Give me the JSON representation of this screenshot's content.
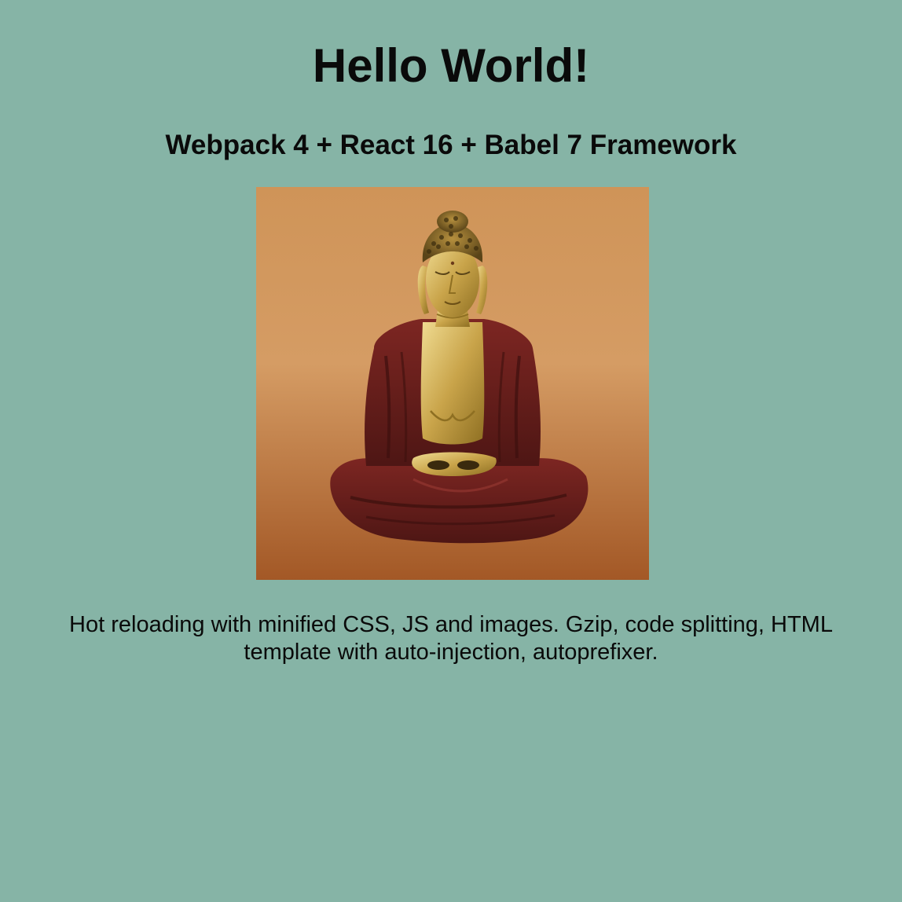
{
  "header": {
    "title": "Hello World!",
    "subtitle": "Webpack 4 + React 16 + Babel 7 Framework"
  },
  "image": {
    "subject": "seated-buddha-statue"
  },
  "body": {
    "description": "Hot reloading with minified CSS, JS and images. Gzip, code splitting, HTML template with auto-injection, autoprefixer."
  },
  "colors": {
    "background": "#86b4a6",
    "text": "#0a0a0a",
    "image_bg_top": "#d09860",
    "image_bg_bottom": "#a65a26",
    "robe": "#6e1f1c",
    "gold": "#c9a94e"
  }
}
